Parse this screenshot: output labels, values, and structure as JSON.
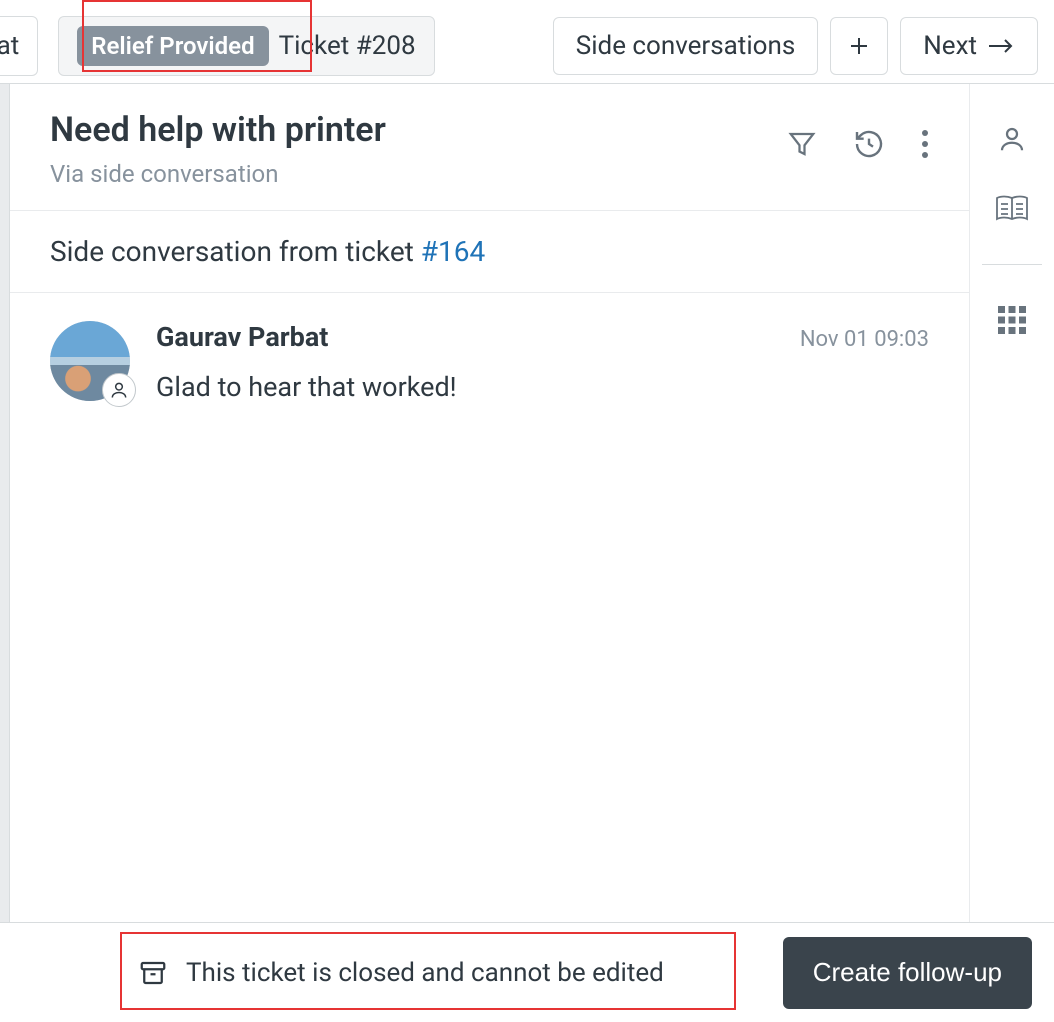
{
  "tabs": {
    "partial_left": "bat",
    "active": {
      "pill": "Relief Provided",
      "label": "Ticket #208"
    }
  },
  "toolbar": {
    "side_conversations": "Side conversations",
    "next": "Next"
  },
  "header": {
    "title": "Need help with printer",
    "subtitle": "Via side conversation"
  },
  "from_strip": {
    "prefix": "Side conversation from ticket ",
    "link_text": "#164"
  },
  "message": {
    "author": "Gaurav Parbat",
    "timestamp": "Nov 01 09:03",
    "body": "Glad to hear that worked!"
  },
  "footer": {
    "closed_text": "This ticket is closed and cannot be edited",
    "follow_up": "Create follow-up"
  }
}
